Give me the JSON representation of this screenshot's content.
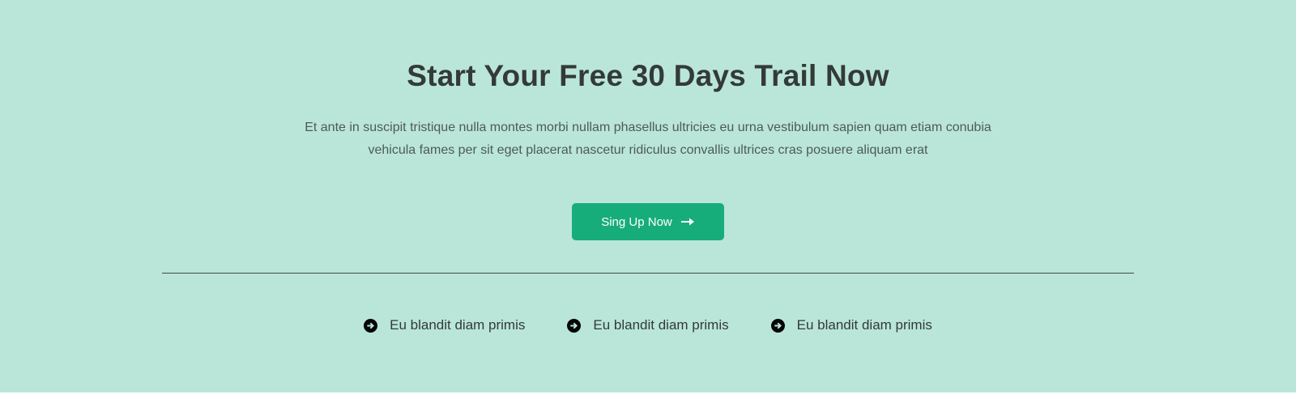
{
  "cta": {
    "title": "Start Your Free 30 Days Trail Now",
    "description": "Et ante in suscipit tristique nulla montes morbi nullam phasellus ultricies eu urna vestibulum sapien quam etiam conubia vehicula fames per sit eget placerat nascetur ridiculus convallis ultrices cras posuere aliquam erat",
    "button_label": "Sing Up Now",
    "button_icon": "arrow-right-icon"
  },
  "features": [
    {
      "label": "Eu blandit diam primis",
      "icon": "arrow-circle-right-icon"
    },
    {
      "label": "Eu blandit diam primis",
      "icon": "arrow-circle-right-icon"
    },
    {
      "label": "Eu blandit diam primis",
      "icon": "arrow-circle-right-icon"
    }
  ],
  "colors": {
    "section_background": "#b9e6d9",
    "button_background": "#17ad7b",
    "heading_text": "#343a37",
    "page_background": "#ffffff"
  }
}
